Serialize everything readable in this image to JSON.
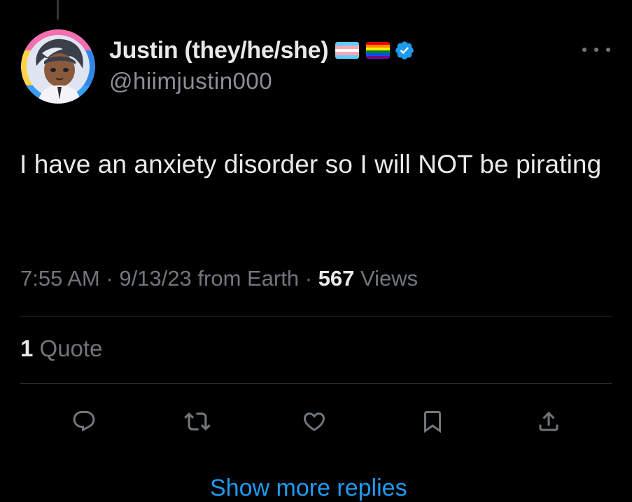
{
  "author": {
    "display_name": "Justin (they/he/she)",
    "handle": "@hiimjustin000",
    "verified": true,
    "badges": [
      "transgender-flag-icon",
      "rainbow-flag-icon",
      "verified-badge-icon"
    ]
  },
  "tweet": {
    "text": "I have an anxiety disorder so I will NOT be pirating",
    "time": "7:55 AM",
    "date": "9/13/23",
    "source": "from Earth",
    "separator": "·",
    "views_count": "567",
    "views_label": "Views"
  },
  "stats": {
    "quotes_count": "1",
    "quotes_label": "Quote"
  },
  "actions": [
    "reply-icon",
    "retweet-icon",
    "like-icon",
    "bookmark-icon",
    "share-icon"
  ],
  "footer": {
    "show_more_replies": "Show more replies"
  },
  "colors": {
    "background": "#000000",
    "text": "#e7e9ea",
    "secondary": "#71767b",
    "accent": "#1d9bf0",
    "divider": "#2f3336"
  }
}
